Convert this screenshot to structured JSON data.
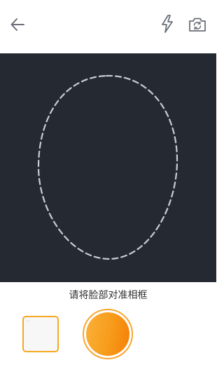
{
  "topbar": {
    "back_icon": "arrow-left-icon",
    "flash_icon": "lightning-icon",
    "switch_icon": "camera-switch-icon",
    "icon_color": "#6b7079"
  },
  "camera": {
    "background_color": "#252a32",
    "frame_color": "#c9ccd1",
    "frame_shape": "dashed-oval"
  },
  "hint": {
    "text": "请将脸部对准相框"
  },
  "bottom": {
    "thumbnail_text": "……",
    "accent_color": "#f7a823"
  }
}
